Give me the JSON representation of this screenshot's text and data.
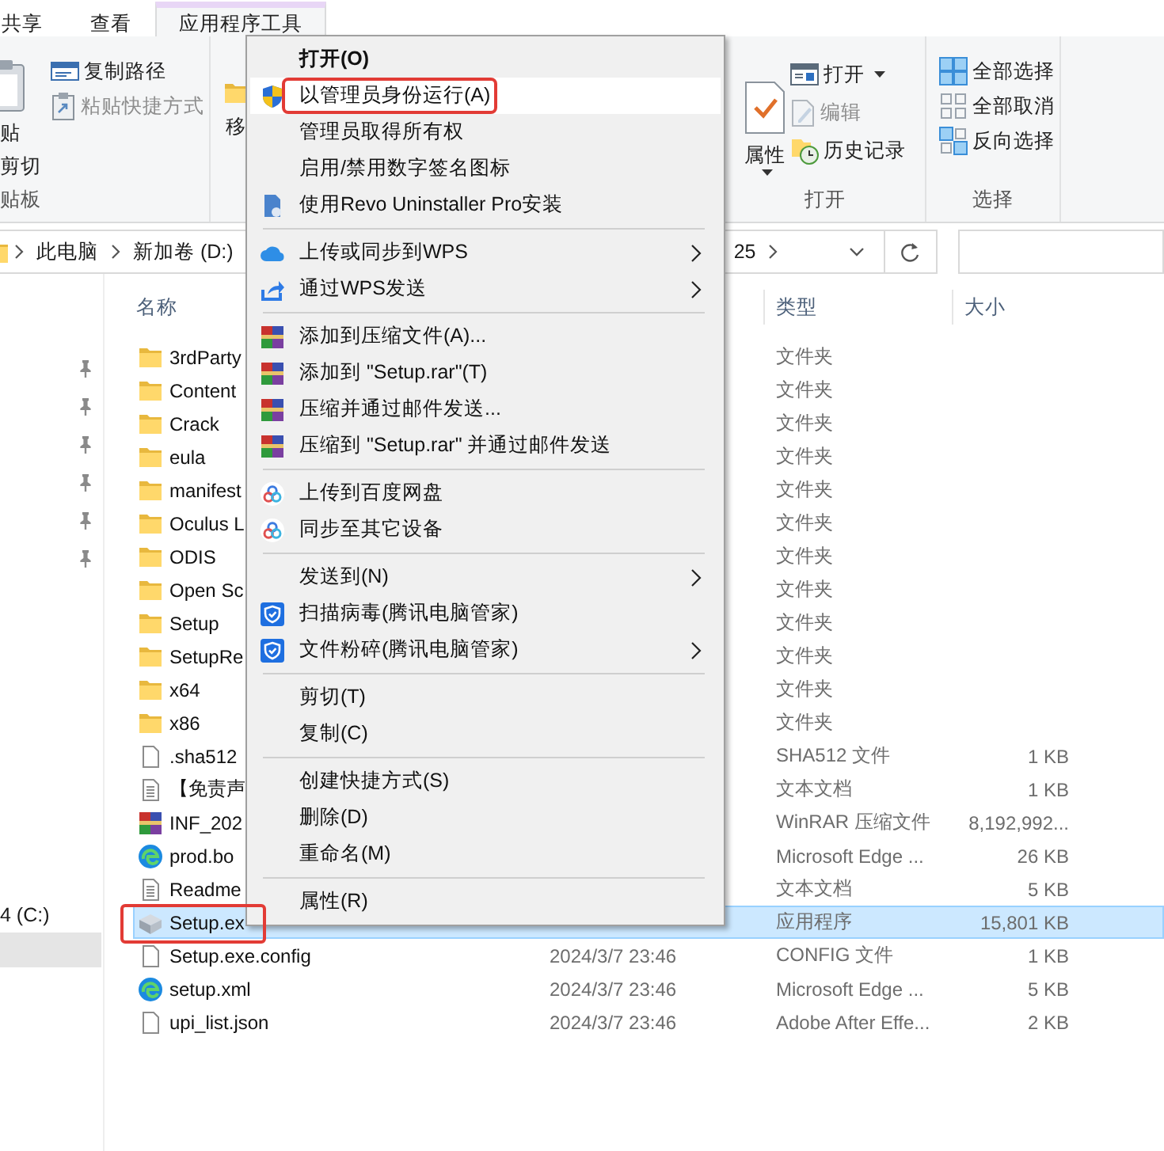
{
  "ribbon_tabs": [
    {
      "label": "共享",
      "selected": false
    },
    {
      "label": "查看",
      "selected": false
    },
    {
      "label": "应用程序工具",
      "selected": true
    }
  ],
  "ribbon": [
    {
      "label": "贴板",
      "large": {
        "label": "贴"
      },
      "small": [
        {
          "label": "剪切",
          "kind": "stacked",
          "disabled": false
        },
        {
          "label": "复制路径",
          "kind": "side",
          "disabled": false
        },
        {
          "label": "粘贴快捷方式",
          "kind": "side",
          "disabled": true
        }
      ]
    },
    {
      "large": {
        "label": "移"
      }
    },
    {
      "label": "打开",
      "large": {
        "label": "属性",
        "dropdown": true
      },
      "small": [
        {
          "label": "打开",
          "kind": "side",
          "dropdown": true,
          "disabled": false
        },
        {
          "label": "编辑",
          "kind": "side",
          "disabled": true
        },
        {
          "label": "历史记录",
          "kind": "side",
          "disabled": false
        }
      ]
    },
    {
      "label": "选择",
      "small": [
        {
          "label": "全部选择",
          "kind": "side",
          "disabled": false
        },
        {
          "label": "全部取消",
          "kind": "side",
          "disabled": false
        },
        {
          "label": "反向选择",
          "kind": "side",
          "disabled": false
        }
      ]
    }
  ],
  "address": {
    "crumbs": [
      {
        "label": "此电脑"
      },
      {
        "label": "新加卷 (D:)"
      },
      {
        "label": "25"
      }
    ]
  },
  "sidebar": {
    "items": [
      {
        "pinned": true,
        "selected": false
      },
      {
        "pinned": true,
        "selected": false
      },
      {
        "pinned": true,
        "selected": false
      },
      {
        "pinned": true,
        "selected": false
      },
      {
        "pinned": true,
        "selected": false
      },
      {
        "pinned": true,
        "selected": false
      },
      {
        "label": "4 (C:)",
        "pinned": false,
        "selected": false
      },
      {
        "pinned": false,
        "selected": true
      }
    ]
  },
  "columns": {
    "name": "名称",
    "type": "类型",
    "size": "大小"
  },
  "rows": [
    {
      "name": "3rdParty",
      "kind": "folder",
      "type": "文件夹",
      "selected": false
    },
    {
      "name": "Content",
      "kind": "folder",
      "type": "文件夹",
      "selected": false
    },
    {
      "name": "Crack",
      "kind": "folder",
      "type": "文件夹",
      "selected": false
    },
    {
      "name": "eula",
      "kind": "folder",
      "type": "文件夹",
      "selected": false
    },
    {
      "name": "manifest",
      "kind": "folder",
      "type": "文件夹",
      "selected": false
    },
    {
      "name": "Oculus L",
      "kind": "folder",
      "type": "文件夹",
      "selected": false
    },
    {
      "name": "ODIS",
      "kind": "folder",
      "type": "文件夹",
      "selected": false
    },
    {
      "name": "Open Sc",
      "kind": "folder",
      "type": "文件夹",
      "selected": false
    },
    {
      "name": "Setup",
      "kind": "folder",
      "type": "文件夹",
      "selected": false
    },
    {
      "name": "SetupRe",
      "kind": "folder",
      "type": "文件夹",
      "selected": false
    },
    {
      "name": "x64",
      "kind": "folder",
      "type": "文件夹",
      "selected": false
    },
    {
      "name": "x86",
      "kind": "folder",
      "type": "文件夹",
      "selected": false
    },
    {
      "name": ".sha512",
      "kind": "file",
      "type": "SHA512 文件",
      "size": "1 KB",
      "selected": false
    },
    {
      "name": "【免责声",
      "kind": "text",
      "type": "文本文档",
      "size": "1 KB",
      "selected": false
    },
    {
      "name": "INF_202",
      "kind": "archive",
      "type": "WinRAR 压缩文件",
      "size": "8,192,992...",
      "selected": false
    },
    {
      "name": "prod.bo",
      "kind": "web",
      "type": "Microsoft Edge ...",
      "size": "26 KB",
      "selected": false
    },
    {
      "name": "Readme",
      "kind": "text",
      "type": "文本文档",
      "size": "5 KB",
      "selected": false
    },
    {
      "name": "Setup.ex",
      "kind": "app",
      "type": "应用程序",
      "size": "15,801 KB",
      "selected": true,
      "highlighted": true
    },
    {
      "name": "Setup.exe.config",
      "kind": "file",
      "date": "2024/3/7 23:46",
      "type": "CONFIG 文件",
      "size": "1 KB",
      "selected": false
    },
    {
      "name": "setup.xml",
      "kind": "web",
      "date": "2024/3/7 23:46",
      "type": "Microsoft Edge ...",
      "size": "5 KB",
      "selected": false
    },
    {
      "name": "upi_list.json",
      "kind": "file",
      "date": "2024/3/7 23:46",
      "type": "Adobe After Effe...",
      "size": "2 KB",
      "selected": false
    }
  ],
  "context_menu": [
    {
      "kind": "plain",
      "label": "打开(O)",
      "default": true,
      "hovered": false,
      "submenu": false
    },
    {
      "kind": "shield",
      "label": "以管理员身份运行(A)",
      "default": false,
      "hovered": true,
      "submenu": false,
      "highlighted": true
    },
    {
      "kind": "plain",
      "label": "管理员取得所有权",
      "default": false,
      "hovered": false,
      "submenu": false
    },
    {
      "kind": "plain",
      "label": "启用/禁用数字签名图标",
      "default": false,
      "hovered": false,
      "submenu": false
    },
    {
      "kind": "uninstaller",
      "label": "使用Revo Uninstaller Pro安装",
      "default": false,
      "hovered": false,
      "submenu": false
    },
    {
      "kind": "separator"
    },
    {
      "kind": "cloud",
      "label": "上传或同步到WPS",
      "default": false,
      "hovered": false,
      "submenu": true
    },
    {
      "kind": "share",
      "label": "通过WPS发送",
      "default": false,
      "hovered": false,
      "submenu": true
    },
    {
      "kind": "separator"
    },
    {
      "kind": "archive",
      "label": "添加到压缩文件(A)...",
      "default": false,
      "hovered": false,
      "submenu": false
    },
    {
      "kind": "archive",
      "label": "添加到 \"Setup.rar\"(T)",
      "default": false,
      "hovered": false,
      "submenu": false
    },
    {
      "kind": "archive",
      "label": "压缩并通过邮件发送...",
      "default": false,
      "hovered": false,
      "submenu": false
    },
    {
      "kind": "archive",
      "label": "压缩到 \"Setup.rar\" 并通过邮件发送",
      "default": false,
      "hovered": false,
      "submenu": false
    },
    {
      "kind": "separator"
    },
    {
      "kind": "netdisk",
      "label": "上传到百度网盘",
      "default": false,
      "hovered": false,
      "submenu": false
    },
    {
      "kind": "netdisk",
      "label": "同步至其它设备",
      "default": false,
      "hovered": false,
      "submenu": false
    },
    {
      "kind": "separator"
    },
    {
      "kind": "plain",
      "label": "发送到(N)",
      "default": false,
      "hovered": false,
      "submenu": true
    },
    {
      "kind": "guard",
      "label": "扫描病毒(腾讯电脑管家)",
      "default": false,
      "hovered": false,
      "submenu": false
    },
    {
      "kind": "guard",
      "label": "文件粉碎(腾讯电脑管家)",
      "default": false,
      "hovered": false,
      "submenu": true
    },
    {
      "kind": "separator"
    },
    {
      "kind": "plain",
      "label": "剪切(T)",
      "default": false,
      "hovered": false,
      "submenu": false
    },
    {
      "kind": "plain",
      "label": "复制(C)",
      "default": false,
      "hovered": false,
      "submenu": false
    },
    {
      "kind": "separator"
    },
    {
      "kind": "plain",
      "label": "创建快捷方式(S)",
      "default": false,
      "hovered": false,
      "submenu": false
    },
    {
      "kind": "plain",
      "label": "删除(D)",
      "default": false,
      "hovered": false,
      "submenu": false
    },
    {
      "kind": "plain",
      "label": "重命名(M)",
      "default": false,
      "hovered": false,
      "submenu": false
    },
    {
      "kind": "separator"
    },
    {
      "kind": "plain",
      "label": "属性(R)",
      "default": false,
      "hovered": false,
      "submenu": false
    }
  ]
}
